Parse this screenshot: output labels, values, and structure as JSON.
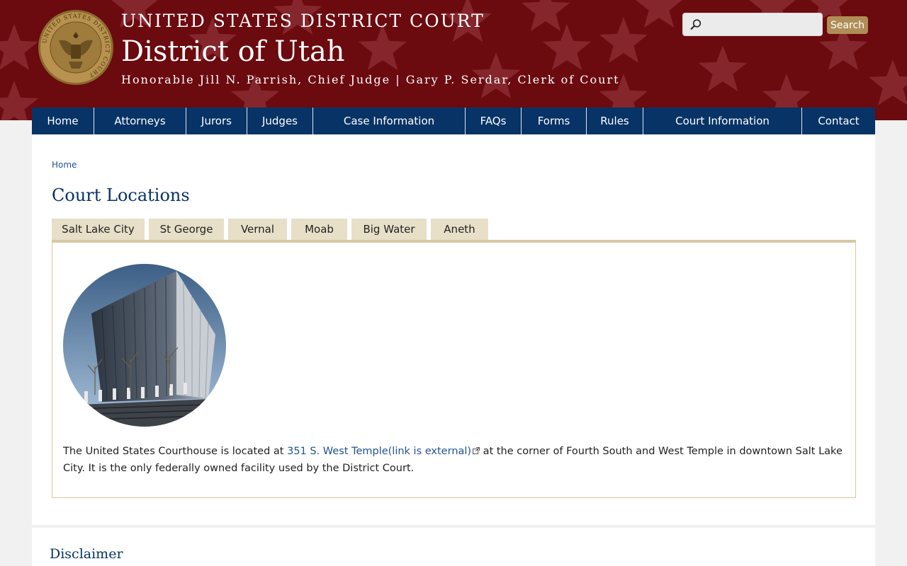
{
  "header": {
    "court_name": "UNITED STATES DISTRICT COURT",
    "district": "District of Utah",
    "subtitle": "Honorable Jill N. Parrish, Chief Judge | Gary P. Serdar, Clerk of Court",
    "seal_icon": "court-seal-icon",
    "seal_text": "UNITED STATES DISTRICT COURT",
    "colors": {
      "banner": "#6b0a0f",
      "star": "#8a2a30"
    }
  },
  "search": {
    "value": "",
    "placeholder": "",
    "button_label": "Search",
    "button_color": "#b08d57"
  },
  "nav": {
    "color": "#073366",
    "items": [
      {
        "label": "Home"
      },
      {
        "label": "Attorneys"
      },
      {
        "label": "Jurors"
      },
      {
        "label": "Judges"
      },
      {
        "label": "Case Information"
      },
      {
        "label": "FAQs"
      },
      {
        "label": "Forms"
      },
      {
        "label": "Rules"
      },
      {
        "label": "Court Information"
      },
      {
        "label": "Contact"
      }
    ]
  },
  "breadcrumb": {
    "home": "Home"
  },
  "page_title": "Court Locations",
  "tabs": [
    {
      "label": "Salt Lake City",
      "active": true
    },
    {
      "label": "St George"
    },
    {
      "label": "Vernal"
    },
    {
      "label": "Moab"
    },
    {
      "label": "Big Water"
    },
    {
      "label": "Aneth"
    }
  ],
  "panel": {
    "photo_icon": "courthouse-photo",
    "text_before": "The United States Courthouse is located at ",
    "link_text": "351 S. West Temple(link is external)",
    "text_after": " at the corner of Fourth South and West Temple in downtown Salt Lake City. It is the only federally owned facility used by the District Court."
  },
  "disclaimer": {
    "title": "Disclaimer"
  }
}
